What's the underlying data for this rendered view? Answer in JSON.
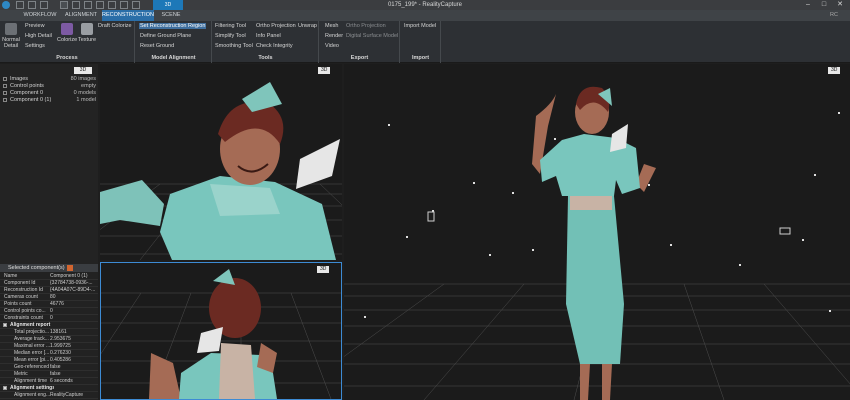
{
  "window": {
    "title": "0175_199* - RealityCapture",
    "view_mode": "3D",
    "minimize": "–",
    "maximize": "□",
    "close": "✕"
  },
  "tabs": [
    "WORKFLOW",
    "ALIGNMENT",
    "RECONSTRUCTION",
    "SCENE"
  ],
  "active_tab": "RECONSTRUCTION",
  "user_badge": "RC",
  "ribbon": {
    "process": {
      "label": "Process",
      "normal_detail": "Normal Detail",
      "preview": "Preview",
      "high_detail": "High Detail",
      "settings": "Settings",
      "colorize": "Colorize",
      "texture": "Texture",
      "draft_colorize": "Draft Colorize"
    },
    "model_alignment": {
      "label": "Model Alignment",
      "set_region": "Set Reconstruction Region",
      "define_ground": "Define Ground Plane",
      "reset_ground": "Reset Ground"
    },
    "tools": {
      "label": "Tools",
      "filtering": "Filtering Tool",
      "simplify": "Simplify Tool",
      "smoothing": "Smoothing Tool",
      "ortho": "Ortho Projection",
      "unwrap": "Unwrap",
      "info": "Info Panel",
      "check": "Check Integrity"
    },
    "export": {
      "label": "Export",
      "mesh": "Mesh",
      "render": "Render",
      "video": "Video",
      "ortho": "Ortho Projection",
      "dsm": "Digital Surface Model"
    },
    "import": {
      "label": "Import",
      "import_model": "Import Model"
    }
  },
  "tree": [
    {
      "label": "Images",
      "value": "80 images"
    },
    {
      "label": "Control points",
      "value": "empty"
    },
    {
      "label": "Component 0",
      "value": "0 models"
    },
    {
      "label": "Component 0 (1)",
      "value": "1 model"
    }
  ],
  "viewports": {
    "top_left_badge": "3D",
    "bottom_left_badge": "3D",
    "main_badge": "3D",
    "top_left_panel_badge": "3D"
  },
  "properties": {
    "header": "Selected component(s)",
    "rows": [
      {
        "k": "Name",
        "v": "Component 0 (1)",
        "type": "row"
      },
      {
        "k": "Component Id",
        "v": "{32784738-0936-...",
        "type": "row"
      },
      {
        "k": "Reconstruction Id",
        "v": "{4A04A07C-89D4-...",
        "type": "row"
      },
      {
        "k": "Cameras count",
        "v": "80",
        "type": "row"
      },
      {
        "k": "Points count",
        "v": "46776",
        "type": "row"
      },
      {
        "k": "Control points co...",
        "v": "0",
        "type": "row"
      },
      {
        "k": "Constraints count",
        "v": "0",
        "type": "row"
      },
      {
        "k": "Alignment report",
        "v": "",
        "type": "sec"
      },
      {
        "k": "Total projectio...",
        "v": "138161",
        "type": "sub"
      },
      {
        "k": "Average track...",
        "v": "2.953675",
        "type": "sub"
      },
      {
        "k": "Maximal error ...",
        "v": "1.999725",
        "type": "sub"
      },
      {
        "k": "Median error [...",
        "v": "0.276230",
        "type": "sub"
      },
      {
        "k": "Mean error [pi...",
        "v": "0.405286",
        "type": "sub"
      },
      {
        "k": "Geo-referenced",
        "v": "false",
        "type": "sub"
      },
      {
        "k": "Metric",
        "v": "false",
        "type": "sub"
      },
      {
        "k": "Alignment time",
        "v": "6 seconds",
        "type": "sub"
      },
      {
        "k": "Alignment settings",
        "v": "",
        "type": "sec"
      },
      {
        "k": "Alignment eng...",
        "v": "RealityCapture",
        "type": "sub"
      }
    ]
  },
  "colors": {
    "accent": "#2a6ea8",
    "figure_teal": "#79c6bd",
    "skin": "#a56b55",
    "hair": "#6b2a22",
    "grid": "#5a5a5a",
    "active_border": "#3d8bd4"
  }
}
